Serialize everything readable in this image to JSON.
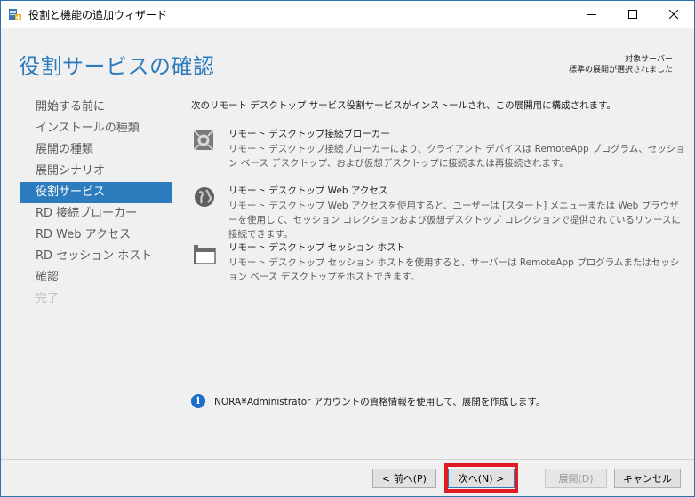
{
  "window": {
    "title": "役割と機能の追加ウィザード"
  },
  "header": {
    "page_title": "役割サービスの確認",
    "target_server_label": "対象サーバー",
    "target_status": "標準の展開が選択されました"
  },
  "nav": {
    "items": [
      {
        "label": "開始する前に",
        "state": "normal"
      },
      {
        "label": "インストールの種類",
        "state": "normal"
      },
      {
        "label": "展開の種類",
        "state": "normal"
      },
      {
        "label": "展開シナリオ",
        "state": "normal"
      },
      {
        "label": "役割サービス",
        "state": "active"
      },
      {
        "label": "RD 接続ブローカー",
        "state": "normal"
      },
      {
        "label": "RD Web アクセス",
        "state": "normal"
      },
      {
        "label": "RD セッション ホスト",
        "state": "normal"
      },
      {
        "label": "確認",
        "state": "normal"
      },
      {
        "label": "完了",
        "state": "disabled"
      }
    ]
  },
  "content": {
    "intro": "次のリモート デスクトップ サービス役割サービスがインストールされ、この展開用に構成されます。",
    "services": [
      {
        "icon": "connection-broker-icon",
        "title": "リモート デスクトップ接続ブローカー",
        "description": "リモート デスクトップ接続ブローカーにより、クライアント デバイスは RemoteApp プログラム、セッション ベース デスクトップ、および仮想デスクトップに接続または再接続されます。"
      },
      {
        "icon": "web-access-globe-icon",
        "title": "リモート デスクトップ Web アクセス",
        "description": "リモート デスクトップ Web アクセスを使用すると、ユーザーは [スタート] メニューまたは Web ブラウザーを使用して、セッション コレクションおよび仮想デスクトップ コレクションで提供されているリソースに接続できます。"
      },
      {
        "icon": "session-host-icon",
        "title": "リモート デスクトップ セッション ホスト",
        "description": "リモート デスクトップ セッション ホストを使用すると、サーバーは RemoteApp プログラムまたはセッション ベース デスクトップをホストできます。"
      }
    ],
    "info_text": "NORA¥Administrator アカウントの資格情報を使用して、展開を作成します。"
  },
  "buttons": {
    "previous": "< 前へ(P)",
    "next": "次へ(N) >",
    "deploy": "展開(D)",
    "cancel": "キャンセル"
  },
  "colors": {
    "accent": "#2c7bbd",
    "highlight": "#e01b24",
    "info": "#1c6fc8"
  }
}
